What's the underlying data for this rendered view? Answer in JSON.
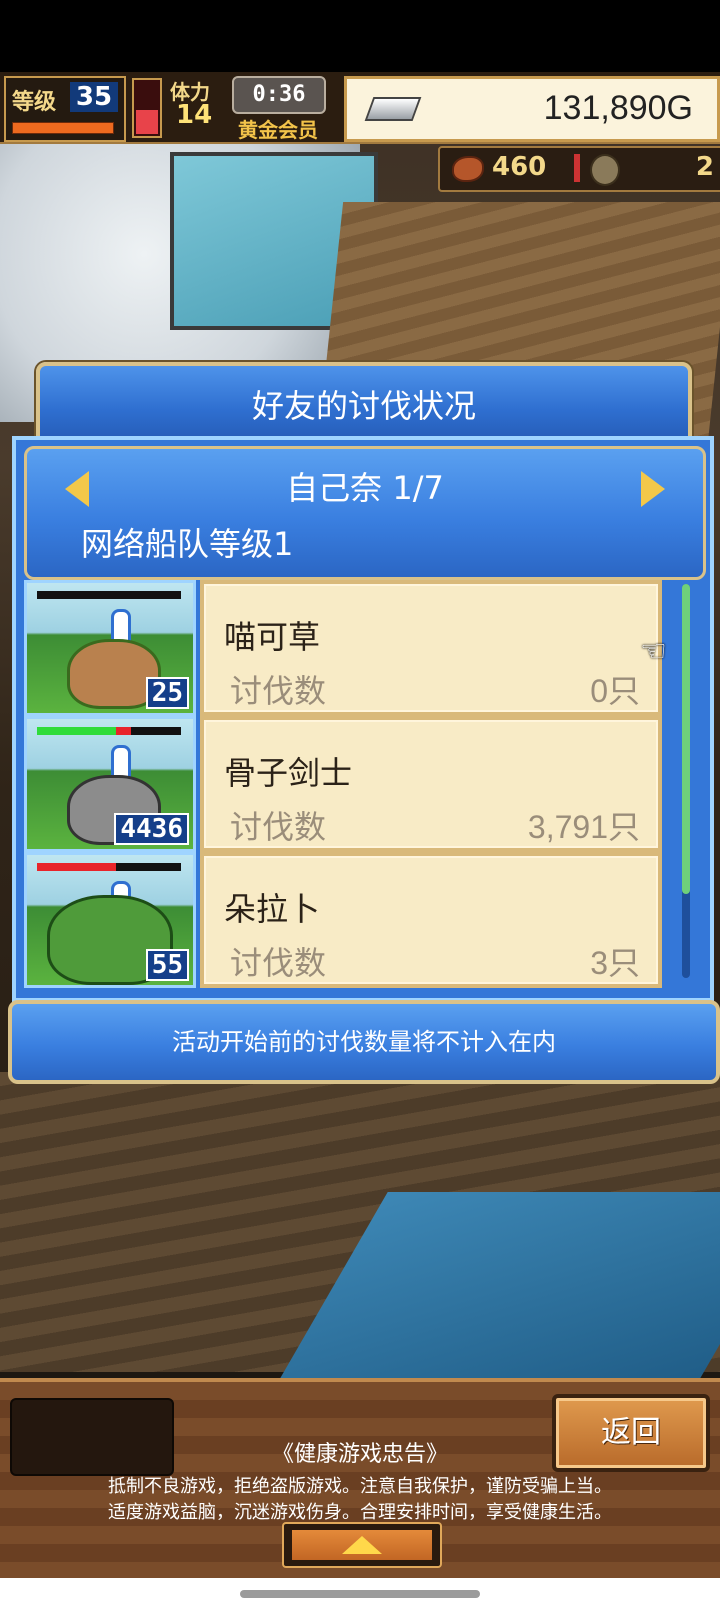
{
  "hud": {
    "level_label": "等级",
    "level": "35",
    "stamina_label": "体力",
    "stamina": "14",
    "timer": "0:36",
    "membership": "黄金会员",
    "money": "131,890G",
    "meat_count": "460",
    "extra_count": "2"
  },
  "dialog": {
    "title": "好友的讨伐状况",
    "friend_name": "自己奈 1/7",
    "fleet_level": "网络船队等级1",
    "rows": [
      {
        "name": "喵可草",
        "kill_label": "讨伐数",
        "kill_count": "0只",
        "level": "25",
        "hp": 0.0
      },
      {
        "name": "骨子剑士",
        "kill_label": "讨伐数",
        "kill_count": "3,791只",
        "level": "4436",
        "hp": 0.55
      },
      {
        "name": "朵拉卜",
        "kill_label": "讨伐数",
        "kill_count": "3只",
        "level": "55",
        "hp": 0.55
      }
    ],
    "notice": "活动开始前的讨伐数量将不计入在内"
  },
  "bottom": {
    "back_label": "返回",
    "health_title": "《健康游戏忠告》",
    "health_line1": "抵制不良游戏，拒绝盗版游戏。注意自我保护，谨防受骗上当。",
    "health_line2": "适度游戏益脑，沉迷游戏伤身。合理安排时间，享受健康生活。"
  },
  "colors": {
    "panel_blue": "#3477d8",
    "card_cream": "#f8ebc6",
    "gold_border": "#d9c28a",
    "hp_green": "#2fdc3a",
    "hp_red": "#e8242a"
  },
  "icons": [
    "silver-ingot-icon",
    "meat-icon",
    "coin-icon",
    "pointer-hand-icon",
    "arrow-left-icon",
    "arrow-right-icon",
    "up-triangle-icon"
  ]
}
